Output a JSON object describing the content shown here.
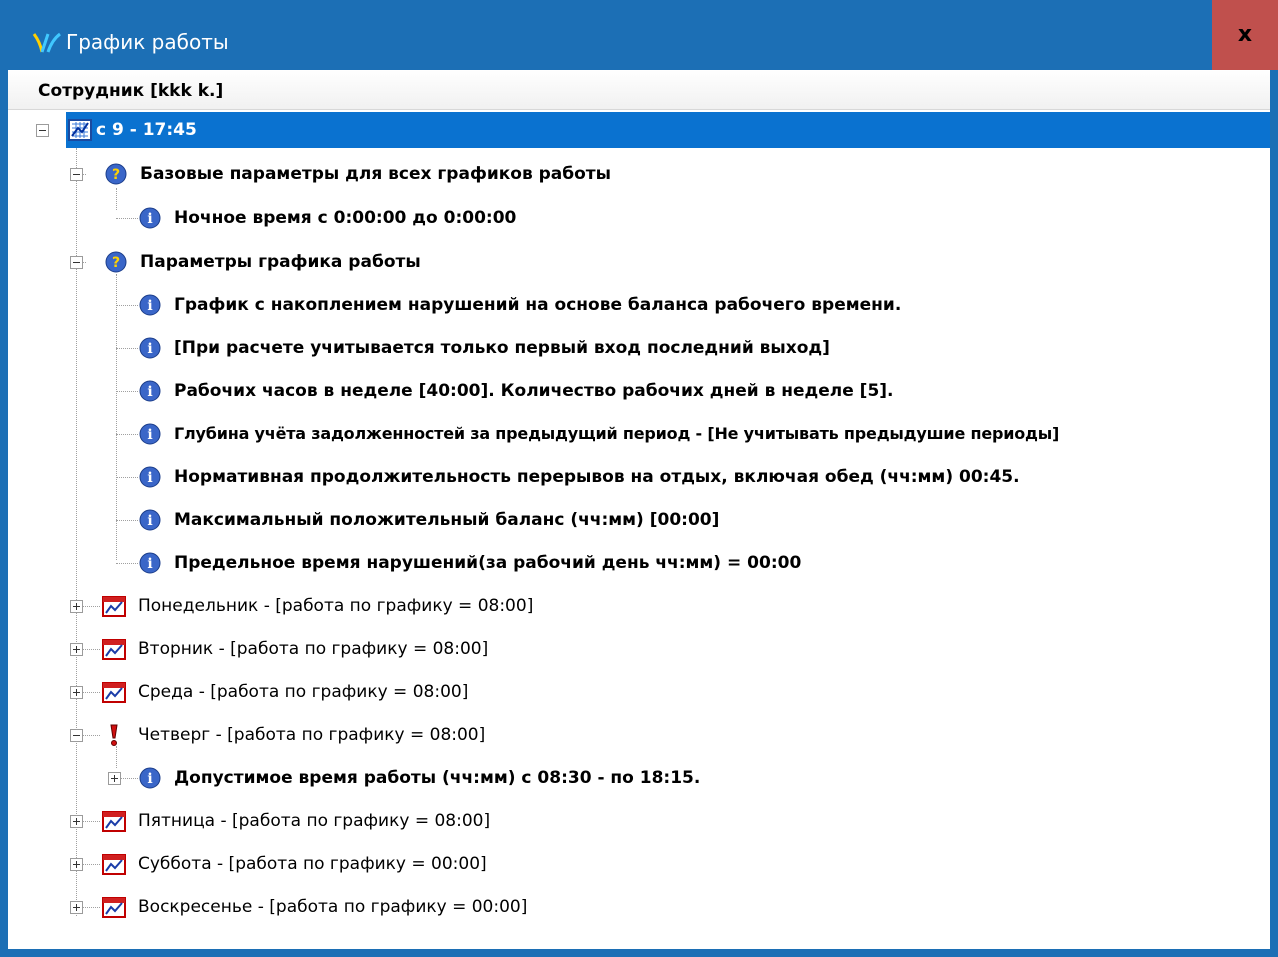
{
  "window": {
    "title": "График работы",
    "close_label": "x",
    "accent_color": "#1c6fb5",
    "close_color": "#c0504d",
    "selection_color": "#0a72d0"
  },
  "header": {
    "label": "Сотрудник [kkk k.]"
  },
  "tree": {
    "root": {
      "label": "с 9 - 17:45",
      "icon": "calendar-grid-icon",
      "expanded": true,
      "selected": true
    },
    "base_params": {
      "label": "Базовые параметры для всех графиков работы",
      "icon": "help-icon"
    },
    "night_time": {
      "label": "Ночное время с 0:00:00 до 0:00:00",
      "icon": "info-icon"
    },
    "schedule_params": {
      "label": "Параметры графика работы",
      "icon": "help-icon"
    },
    "params": [
      "График с накоплением нарушений на основе баланса рабочего времени.",
      "[При расчете учитывается только первый вход последний выход]",
      "Рабочих часов в неделе [40:00]. Количество рабочих дней в неделе [5].",
      "Глубина учёта задолженностей за предыдущий период  - [Не учитывать предыдушие периоды]",
      "Нормативная продолжительность  перерывов на отдых, включая обед (чч:мм) 00:45.",
      "Максимальный положительный баланс (чч:мм) [00:00]",
      "Предельное время нарушений(за рабочий день чч:мм) = 00:00"
    ],
    "days": {
      "monday": "Понедельник - [работа по графику = 08:00]",
      "tuesday": "Вторник - [работа по графику = 08:00]",
      "wednesday": "Среда - [работа по графику = 08:00]",
      "thursday": "Четверг - [работа по графику = 08:00]",
      "thursday_detail": "Допустимое время работы (чч:мм) с 08:30 - по 18:15.",
      "friday": "Пятница - [работа по графику = 08:00]",
      "saturday": "Суббота - [работа по графику = 00:00]",
      "sunday": "Воскресенье - [работа по графику = 00:00]"
    }
  }
}
